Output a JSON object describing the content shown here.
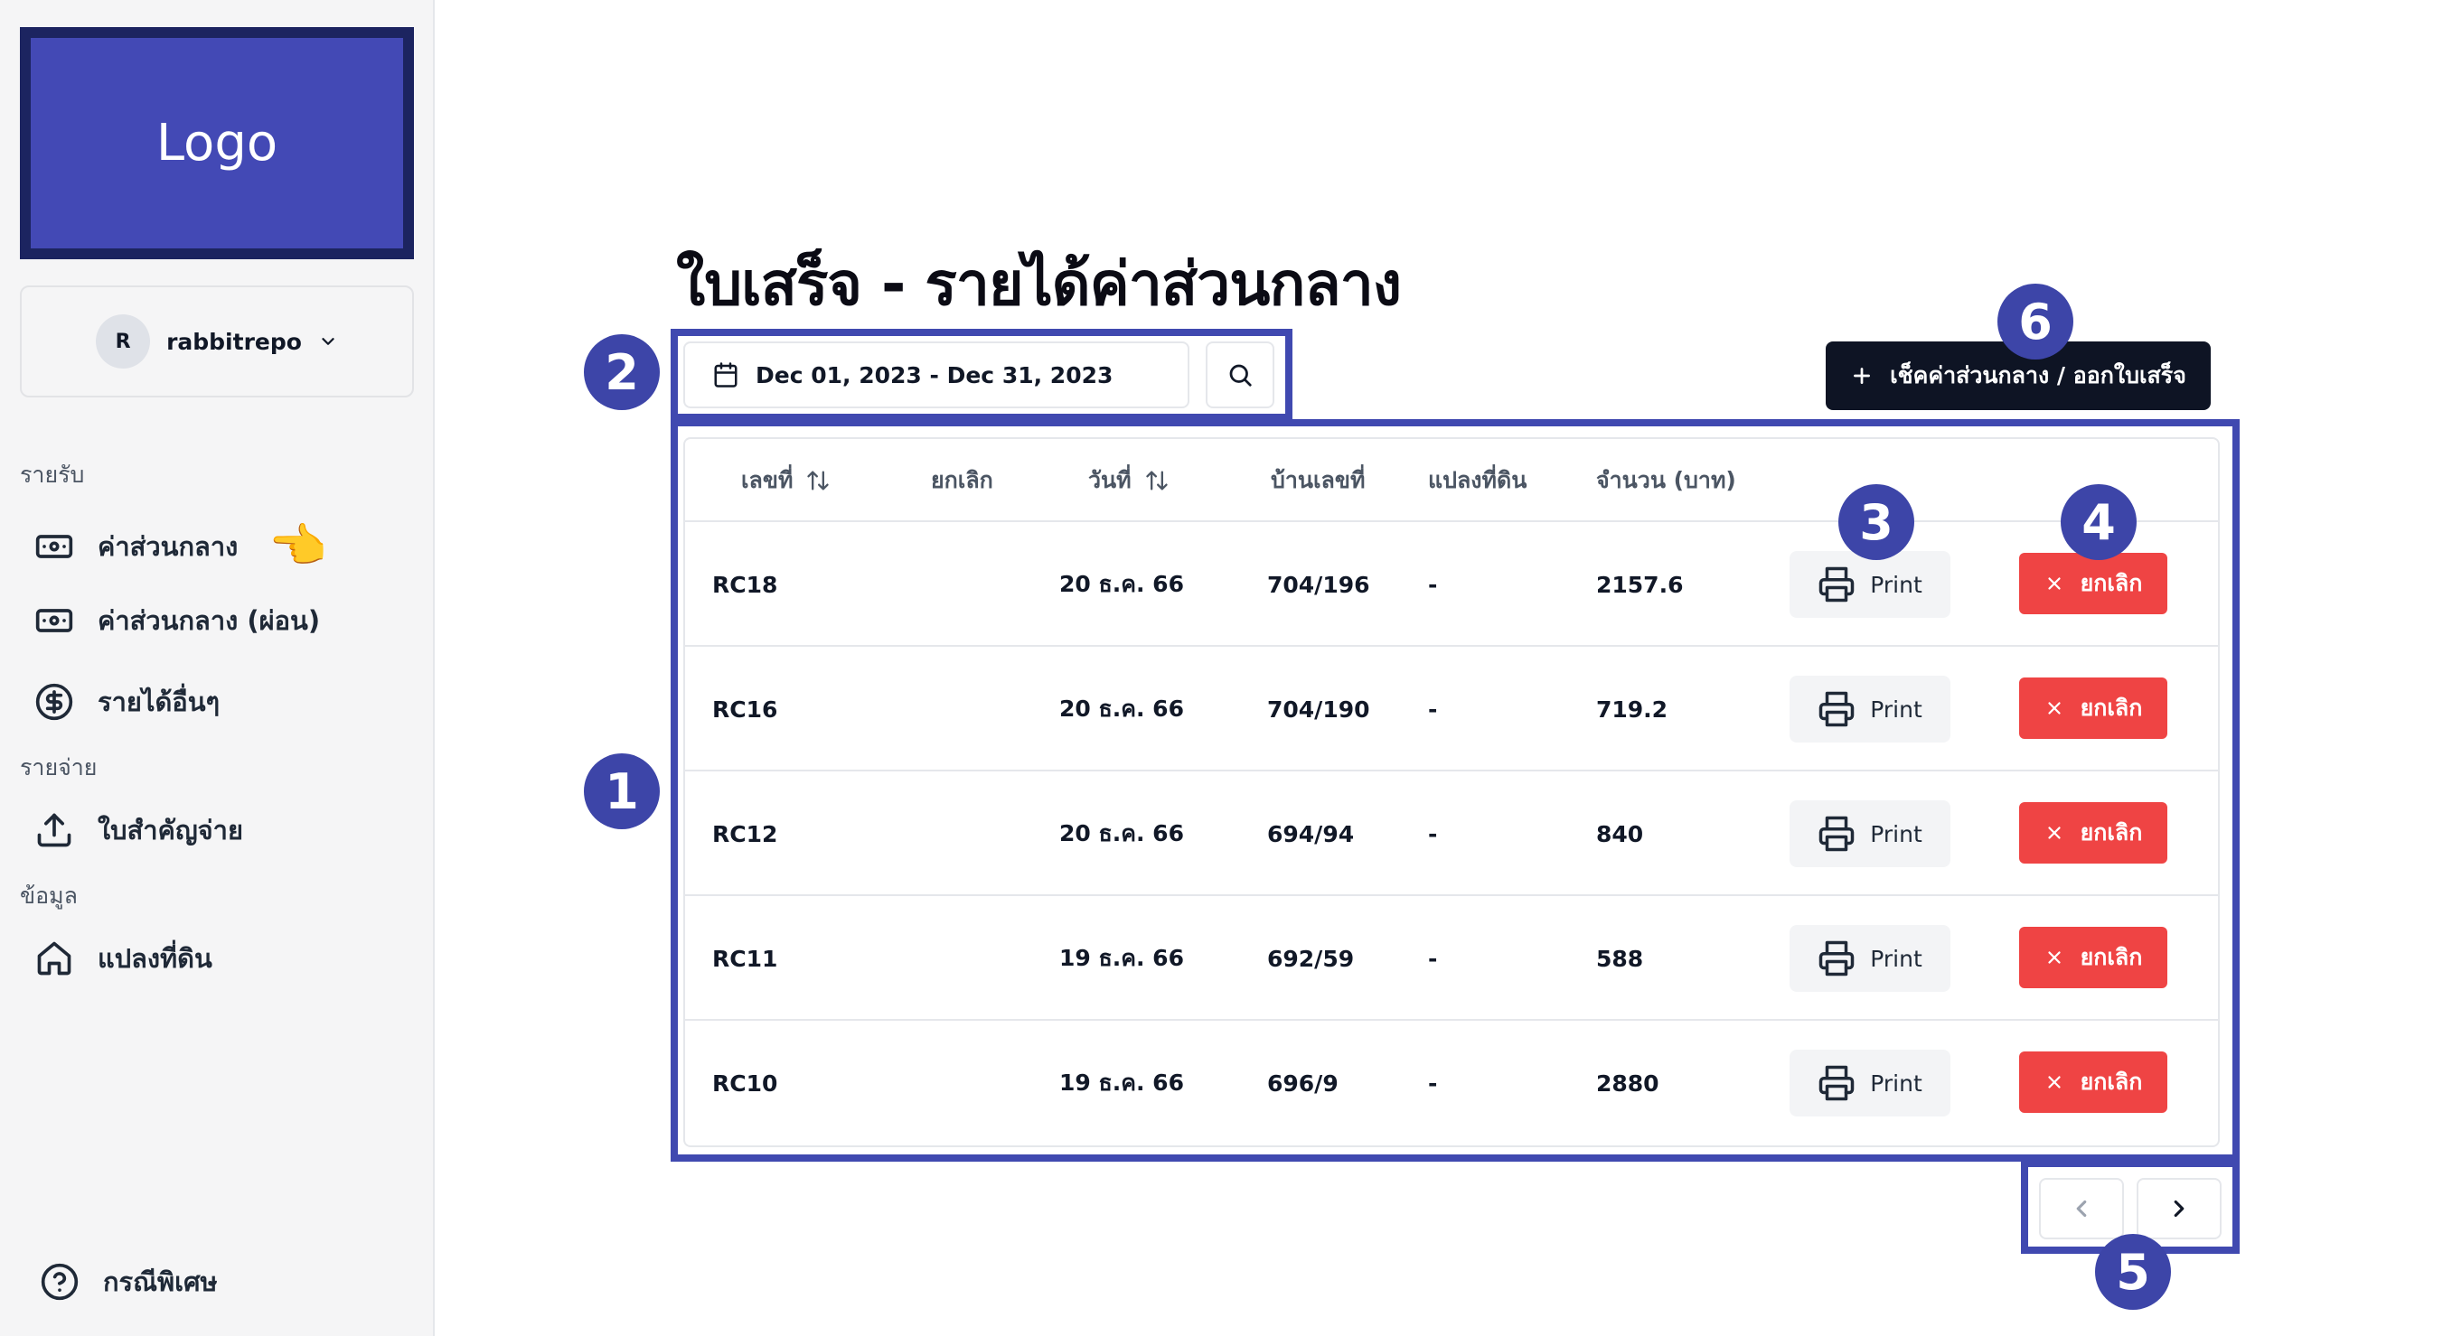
{
  "logo": {
    "label": "Logo"
  },
  "user": {
    "initial": "R",
    "name": "rabbitrepo"
  },
  "sidebar": {
    "income_label": "รายรับ",
    "expense_label": "รายจ่าย",
    "data_label": "ข้อมูล",
    "items": [
      {
        "label": "ค่าส่วนกลาง",
        "icon": "banknote-icon"
      },
      {
        "label": "ค่าส่วนกลาง (ผ่อน)",
        "icon": "banknote-icon"
      },
      {
        "label": "รายได้อื่นๆ",
        "icon": "dollar-circle-icon"
      },
      {
        "label": "ใบสำคัญจ่าย",
        "icon": "upload-icon"
      },
      {
        "label": "แปลงที่ดิน",
        "icon": "home-icon"
      }
    ],
    "footer": {
      "label": "กรณีพิเศษ",
      "icon": "help-circle-icon"
    },
    "pointer": "👈"
  },
  "page": {
    "title": "ใบเสร็จ - รายได้ค่าส่วนกลาง"
  },
  "filter": {
    "date_range": "Dec 01, 2023 - Dec 31, 2023"
  },
  "cta": {
    "label": "เช็คค่าส่วนกลาง / ออกใบเสร็จ"
  },
  "table": {
    "headers": [
      "เลขที่",
      "ยกเลิก",
      "วันที่",
      "บ้านเลขที่",
      "แปลงที่ดิน",
      "จำนวน (บาท)"
    ],
    "print_label": "Print",
    "cancel_label": "ยกเลิก",
    "rows": [
      {
        "no": "RC18",
        "date": "20 ธ.ค. 66",
        "house": "704/196",
        "plot": "-",
        "amount": "2157.6"
      },
      {
        "no": "RC16",
        "date": "20 ธ.ค. 66",
        "house": "704/190",
        "plot": "-",
        "amount": "719.2"
      },
      {
        "no": "RC12",
        "date": "20 ธ.ค. 66",
        "house": "694/94",
        "plot": "-",
        "amount": "840"
      },
      {
        "no": "RC11",
        "date": "19 ธ.ค. 66",
        "house": "692/59",
        "plot": "-",
        "amount": "588"
      },
      {
        "no": "RC10",
        "date": "19 ธ.ค. 66",
        "house": "696/9",
        "plot": "-",
        "amount": "2880"
      }
    ]
  },
  "markers": [
    "1",
    "2",
    "3",
    "4",
    "5",
    "6"
  ],
  "colors": {
    "accent": "#4049b0",
    "danger": "#ef4444",
    "dark": "#0e1424"
  }
}
